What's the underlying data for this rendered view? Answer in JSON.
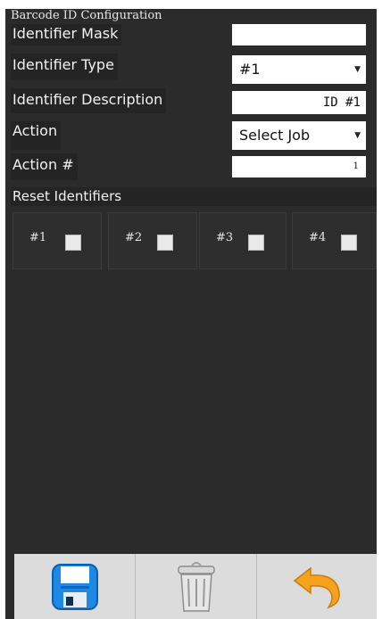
{
  "panel": {
    "title": "Barcode ID Configuration"
  },
  "fields": {
    "identifier_mask": {
      "label": "Identifier Mask",
      "value": ""
    },
    "identifier_type": {
      "label": "Identifier Type",
      "value": "#1"
    },
    "identifier_description": {
      "label": "Identifier Description",
      "value": "ID #1"
    },
    "action": {
      "label": "Action",
      "value": "Select Job"
    },
    "action_number": {
      "label": "Action #",
      "value": "1"
    }
  },
  "reset": {
    "title": "Reset Identifiers",
    "items": [
      {
        "label": "#1",
        "checked": false
      },
      {
        "label": "#2",
        "checked": false
      },
      {
        "label": "#3",
        "checked": false
      },
      {
        "label": "#4",
        "checked": false
      }
    ]
  },
  "toolbar": {
    "buttons": [
      {
        "icon": "save-icon"
      },
      {
        "icon": "trash-icon"
      },
      {
        "icon": "undo-icon"
      }
    ],
    "colors": {
      "save": "#1e88e5",
      "undo": "#f5a21e"
    }
  }
}
